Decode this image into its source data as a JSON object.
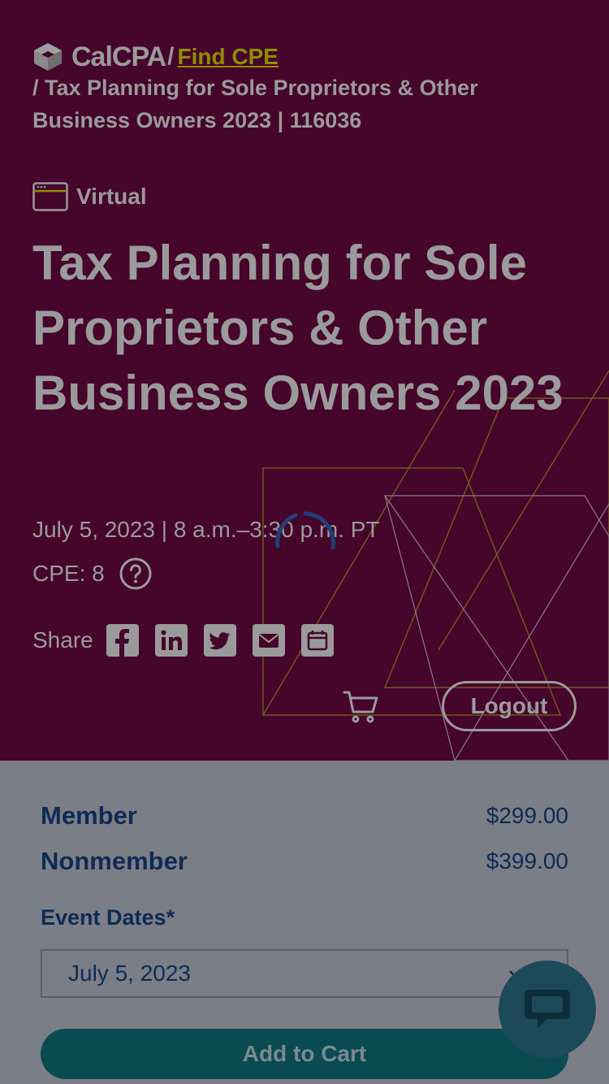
{
  "breadcrumb": {
    "logo_text": "CalCPA",
    "separator": "/",
    "link_label": "Find CPE",
    "current": "/ Tax Planning for Sole Proprietors & Other Business Owners 2023 | 116036"
  },
  "event": {
    "format_label": "Virtual",
    "title": "Tax Planning for Sole Proprietors & Other Business Owners 2023",
    "when": "July 5, 2023 | 8 a.m.–3:30 p.m. PT",
    "cpe": "CPE: 8",
    "share_label": "Share"
  },
  "share_icons": [
    "facebook-icon",
    "linkedin-icon",
    "twitter-icon",
    "email-icon",
    "calendar-icon"
  ],
  "header_actions": {
    "logout_label": "Logout"
  },
  "pricing": {
    "member_label": "Member",
    "member_price": "$299.00",
    "nonmember_label": "Nonmember",
    "nonmember_price": "$399.00"
  },
  "registration": {
    "dates_label": "Event Dates*",
    "selected_date": "July 5, 2023",
    "add_to_cart_label": "Add to Cart"
  },
  "colors": {
    "hero_bg": "#46052b",
    "overlay_text": "#9a9a9a",
    "accent_link": "#8e8e00",
    "panel_text": "#0e2b55",
    "cart_button": "#0a4b52",
    "chat_button": "#1d4a58"
  }
}
